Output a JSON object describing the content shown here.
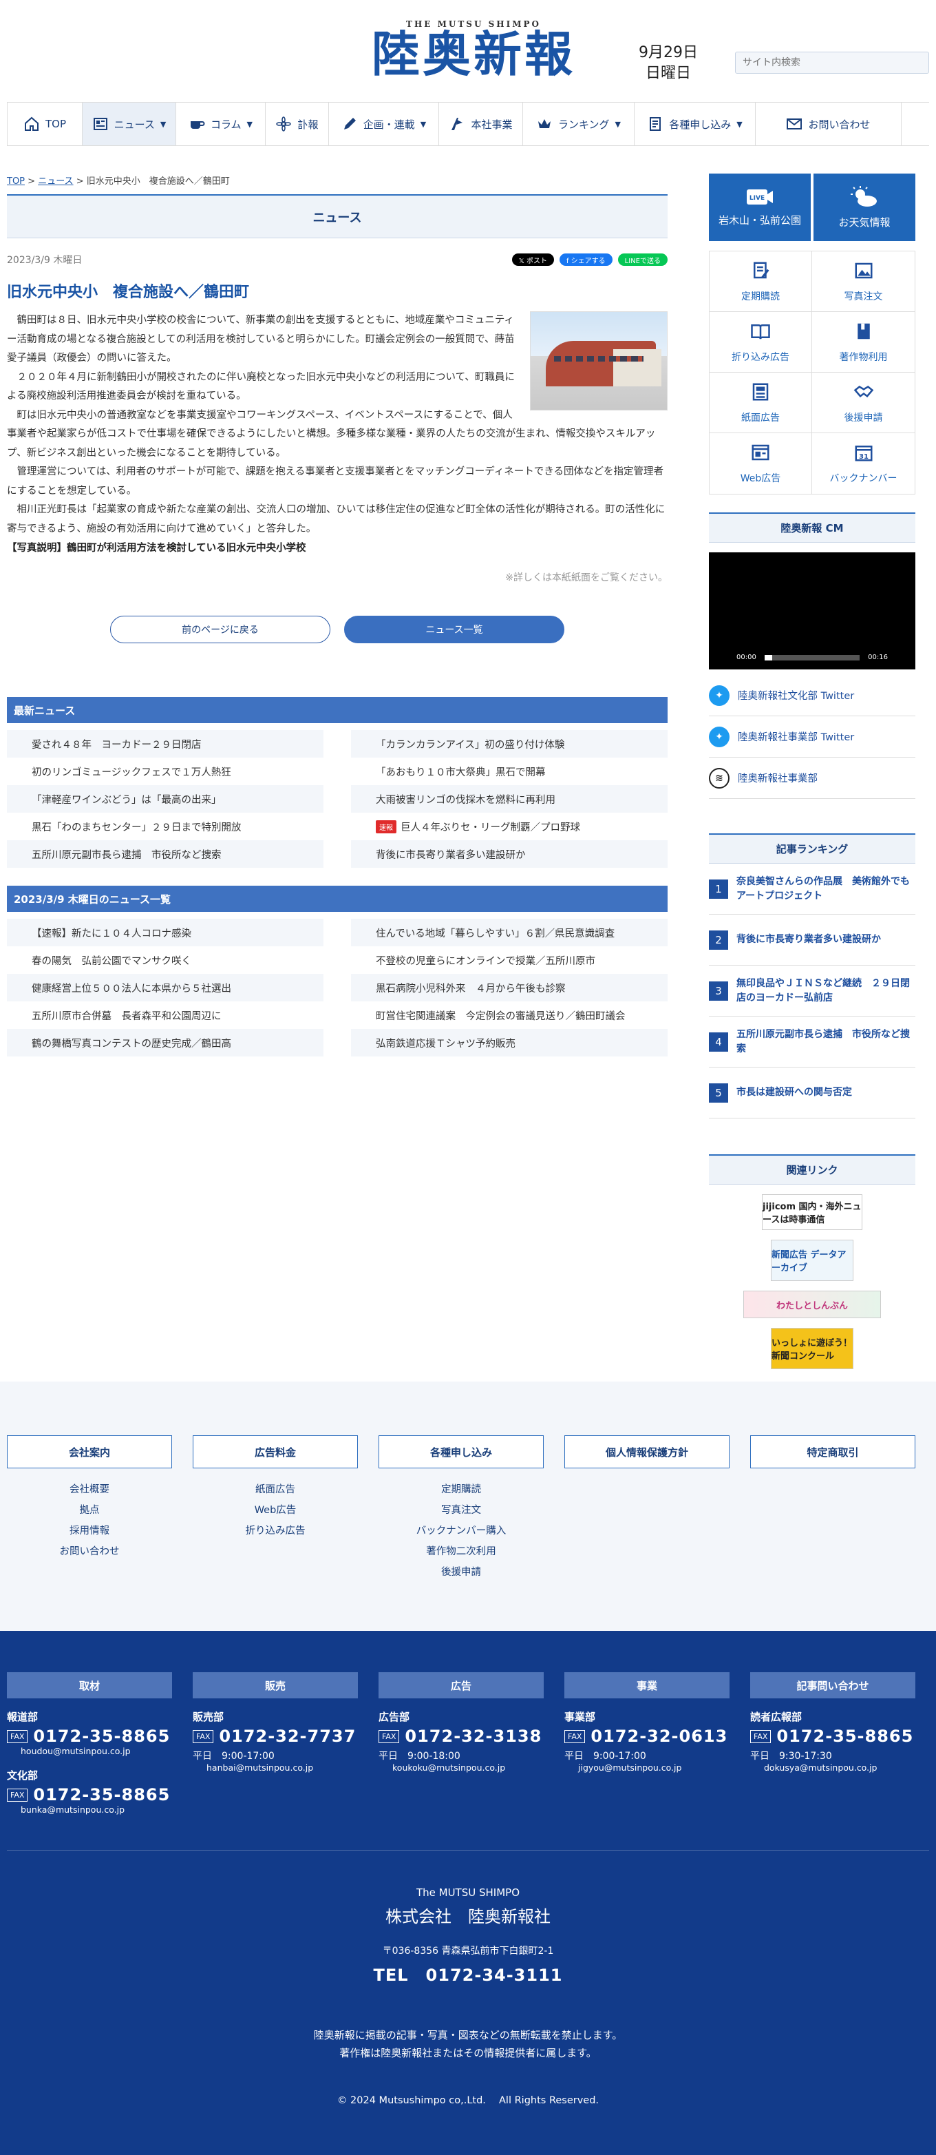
{
  "header": {
    "logo_en": "THE MUTSU SHIMPO",
    "logo_jp": "陸奥新報",
    "date_line1": "9月29日",
    "date_line2": "日曜日",
    "search_placeholder": "サイト内検索"
  },
  "nav": [
    {
      "label": "TOP",
      "icon": "home-icon",
      "arrow": ""
    },
    {
      "label": "ニュース",
      "icon": "newspaper-icon",
      "arrow": "▼"
    },
    {
      "label": "コラム",
      "icon": "coffee-icon",
      "arrow": "▼"
    },
    {
      "label": "訃報",
      "icon": "flower-icon",
      "arrow": ""
    },
    {
      "label": "企画・連載",
      "icon": "pen-icon",
      "arrow": "▼"
    },
    {
      "label": "本社事業",
      "icon": "flag-icon",
      "arrow": ""
    },
    {
      "label": "ランキング",
      "icon": "crown-icon",
      "arrow": "▼"
    },
    {
      "label": "各種申し込み",
      "icon": "form-icon",
      "arrow": "▼"
    },
    {
      "label": "お問い合わせ",
      "icon": "mail-icon",
      "arrow": ""
    }
  ],
  "breadcrumb": {
    "top": "TOP",
    "sep": ">",
    "news": "ニュース",
    "current": "旧水元中央小　複合施設へ／鶴田町"
  },
  "section_title": "ニュース",
  "article": {
    "date": "2023/3/9 木曜日",
    "share_x": "𝕏 ポスト",
    "share_fb": "f シェアする",
    "share_line": "LINEで送る",
    "title": "旧水元中央小　複合施設へ／鶴田町",
    "paragraphs": [
      "鶴田町は８日、旧水元中央小学校の校舎について、新事業の創出を支援するとともに、地域産業やコミュニティー活動育成の場となる複合施設としての利活用を検討していると明らかにした。町議会定例会の一般質問で、蒔苗愛子議員（政優会）の問いに答えた。",
      "２０２０年４月に新制鶴田小が開校されたのに伴い廃校となった旧水元中央小などの利活用について、町職員による廃校施設利活用推進委員会が検討を重ねている。",
      "町は旧水元中央小の普通教室などを事業支援室やコワーキングスペース、イベントスペースにすることで、個人事業者や起業家らが低コストで仕事場を確保できるようにしたいと構想。多種多様な業種・業界の人たちの交流が生まれ、情報交換やスキルアップ、新ビジネス創出といった機会になることを期待している。",
      "管理運営については、利用者のサポートが可能で、課題を抱える事業者と支援事業者とをマッチングコーディネートできる団体などを指定管理者にすることを想定している。",
      "相川正光町長は「起業家の育成や新たな産業の創出、交流人口の増加、ひいては移住定住の促進など町全体の活性化が期待される。町の活性化に寄与できるよう、施設の有効活用に向けて進めていく」と答弁した。"
    ],
    "caption": "【写真説明】鶴田町が利活用方法を検討している旧水元中央小学校",
    "note": "※詳しくは本紙紙面をご覧ください。",
    "back_button": "前のページに戻る",
    "list_button": "ニュース一覧"
  },
  "latest": {
    "title": "最新ニュース",
    "items": [
      {
        "text": "愛され４８年　ヨーカドー２９日閉店",
        "badge": ""
      },
      {
        "text": "「カランカランアイス」初の盛り付け体験",
        "badge": ""
      },
      {
        "text": "初のリンゴミュージックフェスで１万人熱狂",
        "badge": ""
      },
      {
        "text": "「あおもり１０市大祭典」黒石で開幕",
        "badge": ""
      },
      {
        "text": "「津軽産ワインぶどう」は「最高の出来」",
        "badge": ""
      },
      {
        "text": "大雨被害リンゴの伐採木を燃料に再利用",
        "badge": ""
      },
      {
        "text": "黒石「わのまちセンター」２９日まで特別開放",
        "badge": ""
      },
      {
        "text": "巨人４年ぶりセ・リーグ制覇／プロ野球",
        "badge": "速報"
      },
      {
        "text": "五所川原元副市長ら逮捕　市役所など捜索",
        "badge": ""
      },
      {
        "text": "背後に市長寄り業者多い建設研か",
        "badge": ""
      }
    ]
  },
  "day_list": {
    "title": "2023/3/9 木曜日のニュース一覧",
    "items": [
      "【速報】新たに１０４人コロナ感染",
      "住んでいる地域「暮らしやすい」６割／県民意識調査",
      "春の陽気　弘前公園でマンサク咲く",
      "不登校の児童らにオンラインで授業／五所川原市",
      "健康経営上位５００法人に本県から５社選出",
      "黒石病院小児科外来　４月から午後も診察",
      "五所川原市合併墓　長者森平和公園周辺に",
      "町営住宅関連議案　今定例会の審議見送り／鶴田町議会",
      "鶴の舞橋写真コンテストの歴史完成／鶴田高",
      "弘南鉄道応援Ｔシャツ予約販売"
    ]
  },
  "side": {
    "live_label": "LIVE",
    "live_text": "岩木山・弘前公園",
    "weather_text": "お天気情報",
    "grid": [
      {
        "label": "定期購読",
        "icon": "subscribe-icon"
      },
      {
        "label": "写真注文",
        "icon": "photo-icon"
      },
      {
        "label": "折り込み広告",
        "icon": "flyer-icon"
      },
      {
        "label": "著作物利用",
        "icon": "book-icon"
      },
      {
        "label": "紙面広告",
        "icon": "paper-ad-icon"
      },
      {
        "label": "後援申請",
        "icon": "handshake-icon"
      },
      {
        "label": "Web広告",
        "icon": "web-ad-icon"
      },
      {
        "label": "バックナンバー",
        "icon": "calendar-icon"
      }
    ],
    "cm_title": "陸奥新報 CM",
    "video_start": "00:00",
    "video_end": "00:16",
    "video_progress": 0.08,
    "social": [
      {
        "label": "陸奥新報社文化部 Twitter",
        "icon": "twitter-icon"
      },
      {
        "label": "陸奥新報社事業部 Twitter",
        "icon": "twitter-icon"
      },
      {
        "label": "陸奥新報社事業部",
        "icon": "kaonavi-icon"
      }
    ],
    "ranking_title": "記事ランキング",
    "ranking": [
      {
        "n": "1",
        "text": "奈良美智さんらの作品展　美術館外でもアートプロジェクト"
      },
      {
        "n": "2",
        "text": "背後に市長寄り業者多い建設研か"
      },
      {
        "n": "3",
        "text": "無印良品やＪＩＮＳなど継続　２９日閉店のヨーカドー弘前店"
      },
      {
        "n": "4",
        "text": "五所川原元副市長ら逮捕　市役所など捜索"
      },
      {
        "n": "5",
        "text": "市長は建設研への関与否定"
      }
    ],
    "related_title": "関連リンク",
    "banners": [
      "jijicom 国内・海外ニュースは時事通信",
      "新聞広告 データアーカイブ",
      "わたしとしんぶん",
      "いっしょに遊ぼう！新聞コンクール"
    ]
  },
  "footer_links": [
    {
      "title": "会社案内",
      "links": [
        "会社概要",
        "拠点",
        "採用情報",
        "お問い合わせ"
      ]
    },
    {
      "title": "広告料金",
      "links": [
        "紙面広告",
        "Web広告",
        "折り込み広告"
      ]
    },
    {
      "title": "各種申し込み",
      "links": [
        "定期購読",
        "写真注文",
        "バックナンバー購入",
        "著作物二次利用",
        "後援申請"
      ]
    },
    {
      "title": "個人情報保護方針",
      "links": []
    },
    {
      "title": "特定商取引",
      "links": []
    }
  ],
  "contacts": [
    {
      "title": "取材",
      "depts": [
        {
          "name": "報道部",
          "tel": "0172-35-8865",
          "hours": "",
          "mail": "houdou@mutsinpou.co.jp"
        },
        {
          "name": "文化部",
          "tel": "0172-35-8865",
          "hours": "",
          "mail": "bunka@mutsinpou.co.jp"
        }
      ]
    },
    {
      "title": "販売",
      "depts": [
        {
          "name": "販売部",
          "tel": "0172-32-7737",
          "hours": "平日　9:00-17:00",
          "mail": "hanbai@mutsinpou.co.jp"
        }
      ]
    },
    {
      "title": "広告",
      "depts": [
        {
          "name": "広告部",
          "tel": "0172-32-3138",
          "hours": "平日　9:00-18:00",
          "mail": "koukoku@mutsinpou.co.jp"
        }
      ]
    },
    {
      "title": "事業",
      "depts": [
        {
          "name": "事業部",
          "tel": "0172-32-0613",
          "hours": "平日　9:00-17:00",
          "mail": "jigyou@mutsinpou.co.jp"
        }
      ]
    },
    {
      "title": "記事問い合わせ",
      "depts": [
        {
          "name": "読者広報部",
          "tel": "0172-35-8865",
          "hours": "平日　9:30-17:30",
          "mail": "dokusya@mutsinpou.co.jp"
        }
      ]
    }
  ],
  "fax_label": "FAX",
  "corp": {
    "en": "The MUTSU SHIMPO",
    "jp": "株式会社　陸奥新報社",
    "addr": "〒036-8356 青森県弘前市下白銀町2-1",
    "tel": "TEL　0172-34-3111",
    "note1": "陸奥新報に掲載の記事・写真・図表などの無断転載を禁止します。",
    "note2": "著作権は陸奥新報社またはその情報提供者に属します。",
    "copyright": "© 2024 Mutsushimpo co,.Ltd.　 All Rights Reserved."
  },
  "colors": {
    "brand": "#1a54a5",
    "bar": "#3f72c1",
    "footer": "#123b8a"
  }
}
